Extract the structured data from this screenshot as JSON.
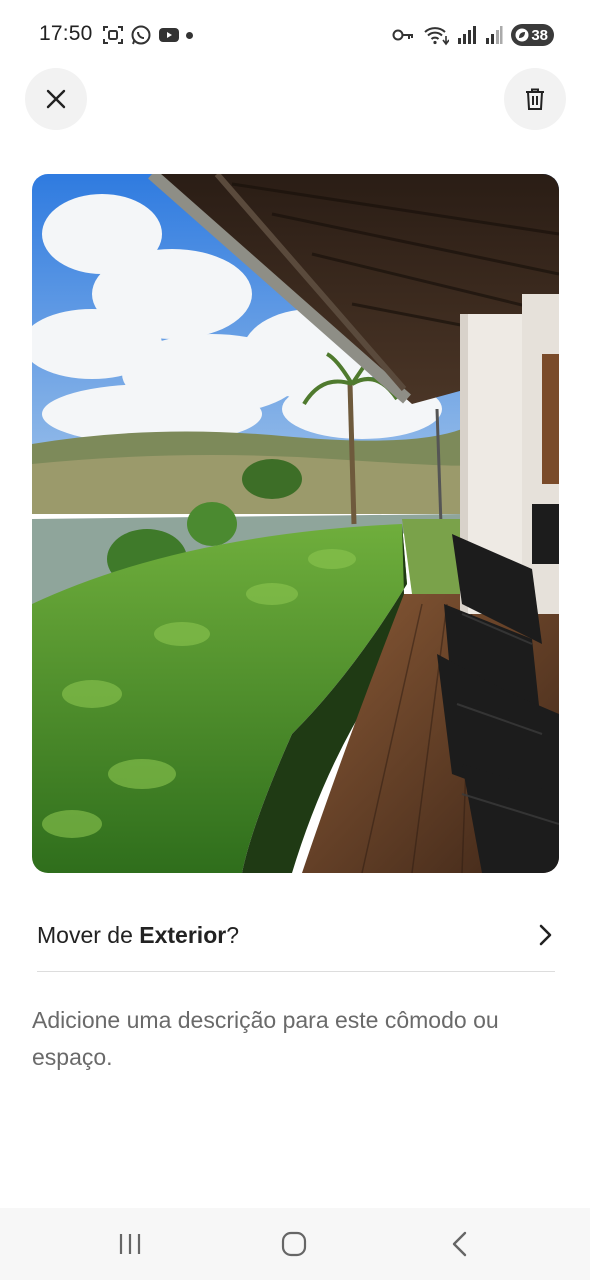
{
  "status_bar": {
    "time": "17:50",
    "left_icons": [
      "screenshot-icon",
      "whatsapp-icon",
      "youtube-icon",
      "notification-dot-icon"
    ],
    "right_icons": [
      "vpn-key-icon",
      "wifi-icon",
      "signal-icon",
      "signal-weak-icon"
    ],
    "battery_level": "38"
  },
  "header": {
    "close_icon": "close-icon",
    "delete_icon": "trash-icon"
  },
  "photo": {
    "subject": "outdoor-veranda-photo"
  },
  "move": {
    "prefix": "Mover de ",
    "room": "Exterior",
    "suffix": "?",
    "icon": "chevron-right-icon"
  },
  "description": {
    "placeholder": "Adicione uma descrição para este cômodo ou espaço."
  },
  "nav": {
    "icons": [
      "recents-icon",
      "home-icon",
      "back-icon"
    ]
  },
  "colors": {
    "text": "#222222",
    "muted": "#6a6a6a",
    "button_bg": "#f2f2f2",
    "divider": "#dddddd",
    "nav_bg": "#f7f7f7"
  }
}
